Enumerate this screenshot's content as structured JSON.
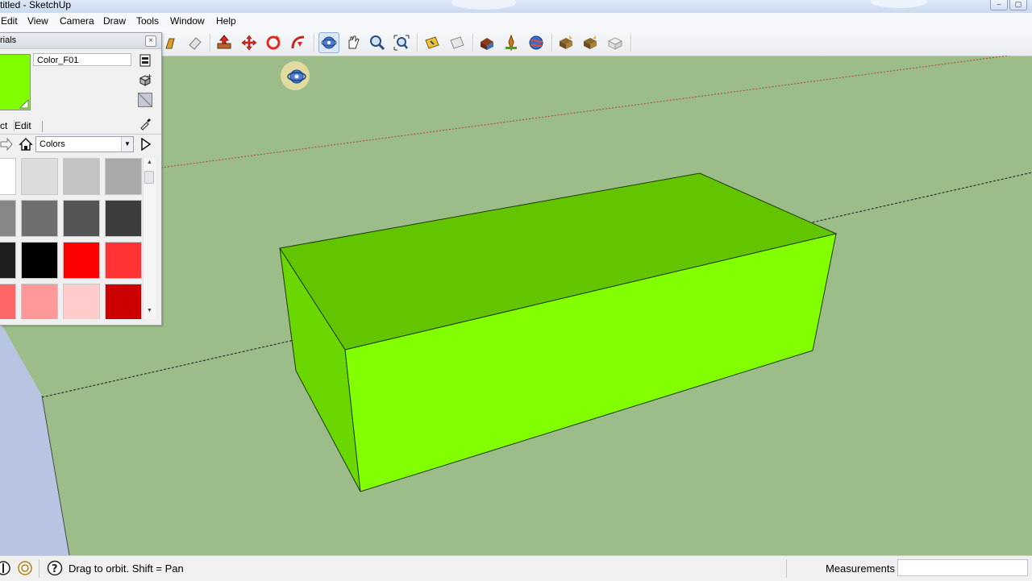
{
  "window": {
    "title": "titled - SketchUp"
  },
  "menu": [
    "Edit",
    "View",
    "Camera",
    "Draw",
    "Tools",
    "Window",
    "Help"
  ],
  "toolbar": {
    "buttons": [
      "walk-icon",
      "eraser-icon",
      "push-pull-icon",
      "move-icon",
      "rotate-icon",
      "follow-me-icon",
      "orbit-icon",
      "pan-icon",
      "zoom-icon",
      "zoom-extents-icon",
      "section-plane-icon",
      "display-section-icon",
      "model-info-icon",
      "add-location-icon",
      "google-earth-icon",
      "get-models-icon",
      "share-model-icon",
      "share-component-icon"
    ]
  },
  "materials": {
    "title": "rials",
    "current_name": "Color_F01",
    "current_color": "#7fff00",
    "tabs": [
      "ct",
      "Edit"
    ],
    "library": "Colors",
    "palette": [
      "#ffffff",
      "#dcdcdc",
      "#c4c4c4",
      "#a9a9a9",
      "#878787",
      "#6e6e6e",
      "#555555",
      "#3c3c3c",
      "#1e1e1e",
      "#000000",
      "#ff0000",
      "#ff3333",
      "#ff6666",
      "#ff9999",
      "#ffcccc",
      "#cc0000"
    ]
  },
  "viewport": {
    "background": "#9cbc8a",
    "box_colors": {
      "top": "#62c500",
      "front": "#82ff00",
      "side": "#6ad800"
    }
  },
  "status": {
    "hint": "Drag to orbit.  Shift = Pan",
    "measurements_label": "Measurements",
    "measurements_value": ""
  }
}
